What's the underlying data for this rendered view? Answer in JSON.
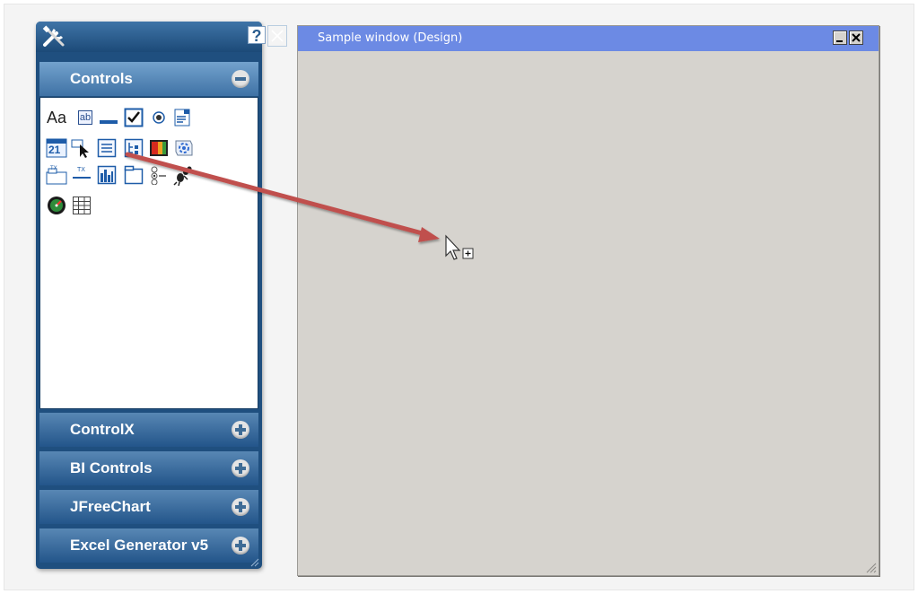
{
  "toolbox": {
    "help_label": "?",
    "sections": [
      {
        "label": "Controls",
        "expanded": true
      },
      {
        "label": "ControlX",
        "expanded": false
      },
      {
        "label": "BI Controls",
        "expanded": false
      },
      {
        "label": "JFreeChart",
        "expanded": false
      },
      {
        "label": "Excel Generator v5",
        "expanded": false
      }
    ],
    "controls": [
      {
        "name": "label-control-icon",
        "text": "Aa"
      },
      {
        "name": "textbox-control-icon",
        "text": "ab"
      },
      {
        "name": "line-control-icon"
      },
      {
        "name": "checkbox-control-icon"
      },
      {
        "name": "radio-control-icon"
      },
      {
        "name": "combobox-control-icon"
      },
      {
        "name": "calendar-control-icon",
        "text": "21"
      },
      {
        "name": "pointer-control-icon"
      },
      {
        "name": "listbox-control-icon"
      },
      {
        "name": "tree-control-icon"
      },
      {
        "name": "image-control-icon"
      },
      {
        "name": "scripting-control-icon"
      },
      {
        "name": "tab-text-control-icon",
        "text": "TX"
      },
      {
        "name": "text-separator-control-icon",
        "text": "TX"
      },
      {
        "name": "bar-chart-control-icon"
      },
      {
        "name": "panel-control-icon"
      },
      {
        "name": "option-group-control-icon"
      },
      {
        "name": "ant-control-icon"
      },
      {
        "name": "gauge-control-icon"
      },
      {
        "name": "grid-control-icon"
      }
    ]
  },
  "window": {
    "title": "Sample window (Design)"
  },
  "colors": {
    "toolbox_body": "#1f4f7f",
    "section_header": "#2d5f93",
    "window_titlebar": "#6c8ae4",
    "window_body": "#d6d3ce",
    "drag_arrow": "#c0504d"
  }
}
